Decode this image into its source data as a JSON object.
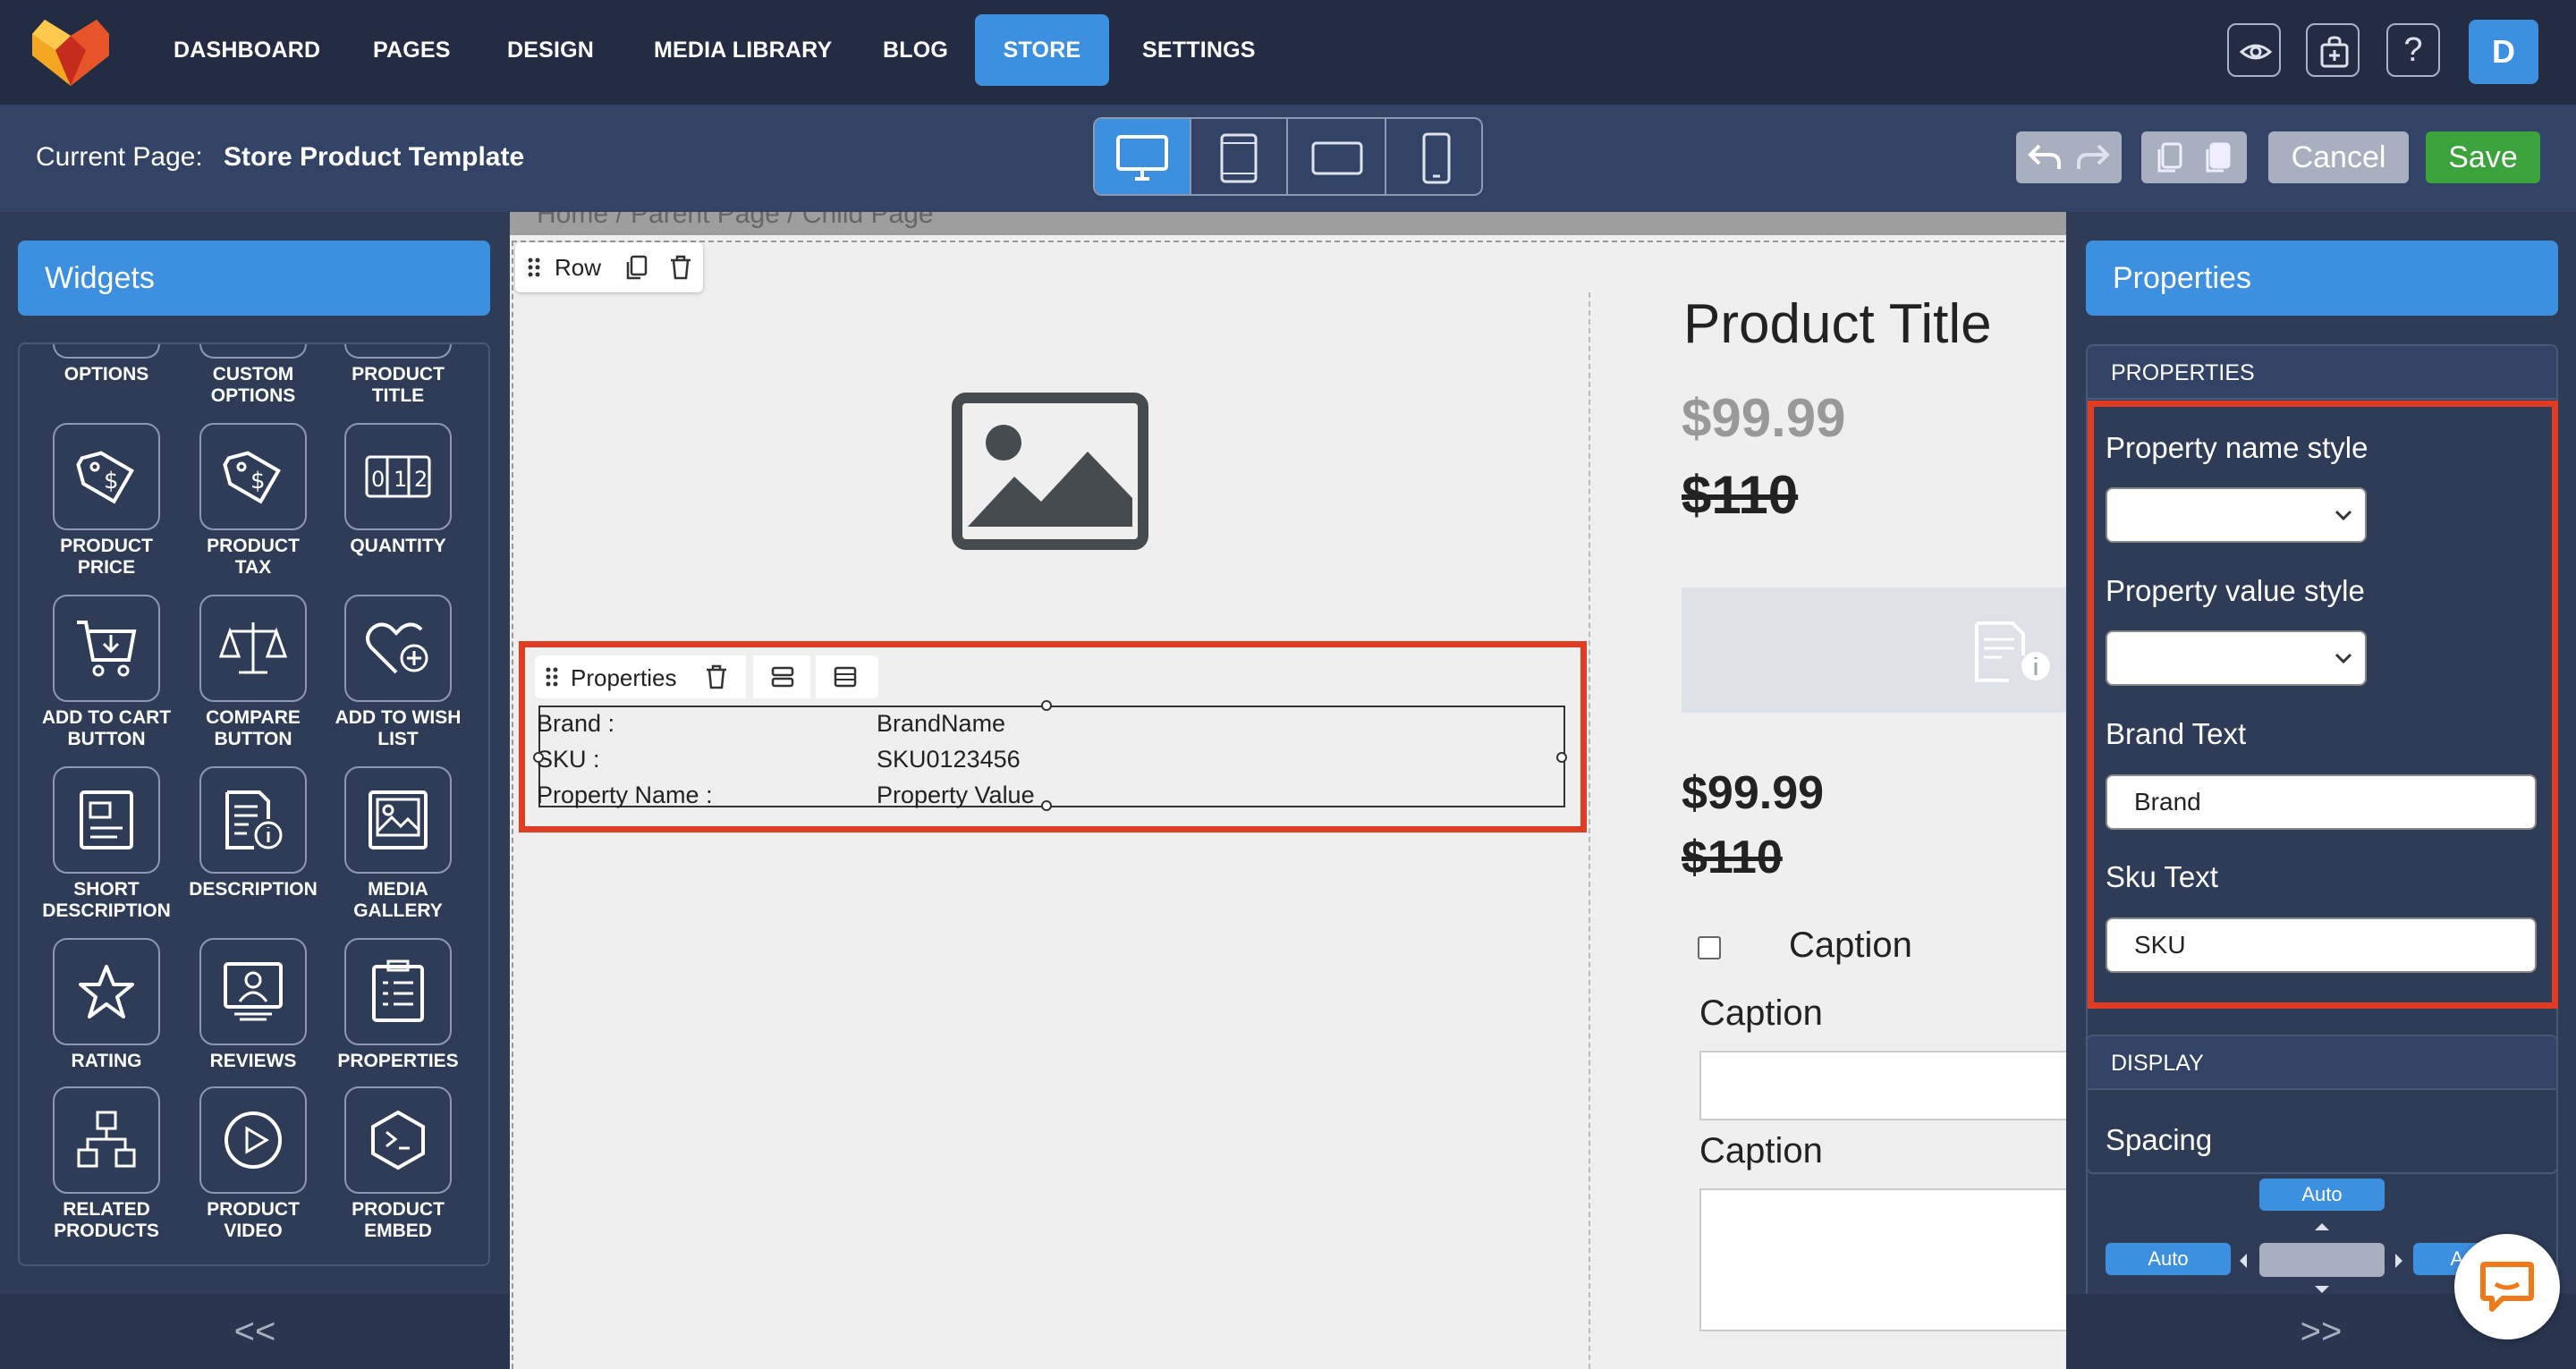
{
  "nav": {
    "items": [
      {
        "label": "DASHBOARD"
      },
      {
        "label": "PAGES"
      },
      {
        "label": "DESIGN"
      },
      {
        "label": "MEDIA LIBRARY"
      },
      {
        "label": "BLOG"
      },
      {
        "label": "STORE",
        "active": true
      },
      {
        "label": "SETTINGS"
      }
    ],
    "help_label": "?",
    "avatar_initial": "D"
  },
  "subbar": {
    "current_page_label": "Current Page:",
    "current_page_value": "Store Product Template",
    "cancel_label": "Cancel",
    "save_label": "Save"
  },
  "left_panel": {
    "title": "Widgets",
    "widgets": [
      {
        "label": "OPTIONS",
        "icon": "options-icon"
      },
      {
        "label": "CUSTOM OPTIONS",
        "icon": "custom-options-icon"
      },
      {
        "label": "PRODUCT TITLE",
        "icon": "product-title-icon"
      },
      {
        "label": "PRODUCT PRICE",
        "icon": "price-tag-icon"
      },
      {
        "label": "PRODUCT TAX",
        "icon": "tax-tag-icon"
      },
      {
        "label": "QUANTITY",
        "icon": "quantity-icon"
      },
      {
        "label": "ADD TO CART BUTTON",
        "icon": "cart-icon"
      },
      {
        "label": "COMPARE BUTTON",
        "icon": "scale-icon"
      },
      {
        "label": "ADD TO WISH LIST",
        "icon": "heart-plus-icon"
      },
      {
        "label": "SHORT DESCRIPTION",
        "icon": "short-description-icon"
      },
      {
        "label": "DESCRIPTION",
        "icon": "description-icon"
      },
      {
        "label": "MEDIA GALLERY",
        "icon": "gallery-icon"
      },
      {
        "label": "RATING",
        "icon": "star-icon"
      },
      {
        "label": "REVIEWS",
        "icon": "reviews-icon"
      },
      {
        "label": "PROPERTIES",
        "icon": "properties-icon"
      },
      {
        "label": "RELATED PRODUCTS",
        "icon": "related-products-icon"
      },
      {
        "label": "PRODUCT VIDEO",
        "icon": "play-icon"
      },
      {
        "label": "PRODUCT EMBED",
        "icon": "embed-icon"
      }
    ],
    "collapse_label": "<<"
  },
  "canvas": {
    "breadcrumb": "Home  /  Parent Page  /  Child Page",
    "row_label": "Row",
    "properties_label": "Properties",
    "properties_rows": [
      {
        "key": "Brand :",
        "value": "BrandName"
      },
      {
        "key": "SKU :",
        "value": "SKU0123456"
      },
      {
        "key": "Property Name :",
        "value": "Property Value"
      }
    ],
    "product_title": "Product Title",
    "price": "$99.99",
    "old_price": "$110",
    "price2": "$99.99",
    "old_price2": "$110",
    "caption_checkbox": "Caption",
    "caption_input": "Caption",
    "caption_area": "Caption"
  },
  "right_panel": {
    "title": "Properties",
    "section_properties": "PROPERTIES",
    "property_name_style_label": "Property name style",
    "property_value_style_label": "Property value style",
    "brand_text_label": "Brand Text",
    "brand_text_value": "Brand",
    "sku_text_label": "Sku Text",
    "sku_text_value": "SKU",
    "section_display": "DISPLAY",
    "spacing_label": "Spacing",
    "spacing_top": "Auto",
    "spacing_left": "Auto",
    "spacing_right": "Au",
    "expand_label": ">>"
  },
  "colors": {
    "accent": "#3d8fe0",
    "save": "#3aa33c",
    "highlight": "#e03b23",
    "nav_bg": "#232c42"
  }
}
